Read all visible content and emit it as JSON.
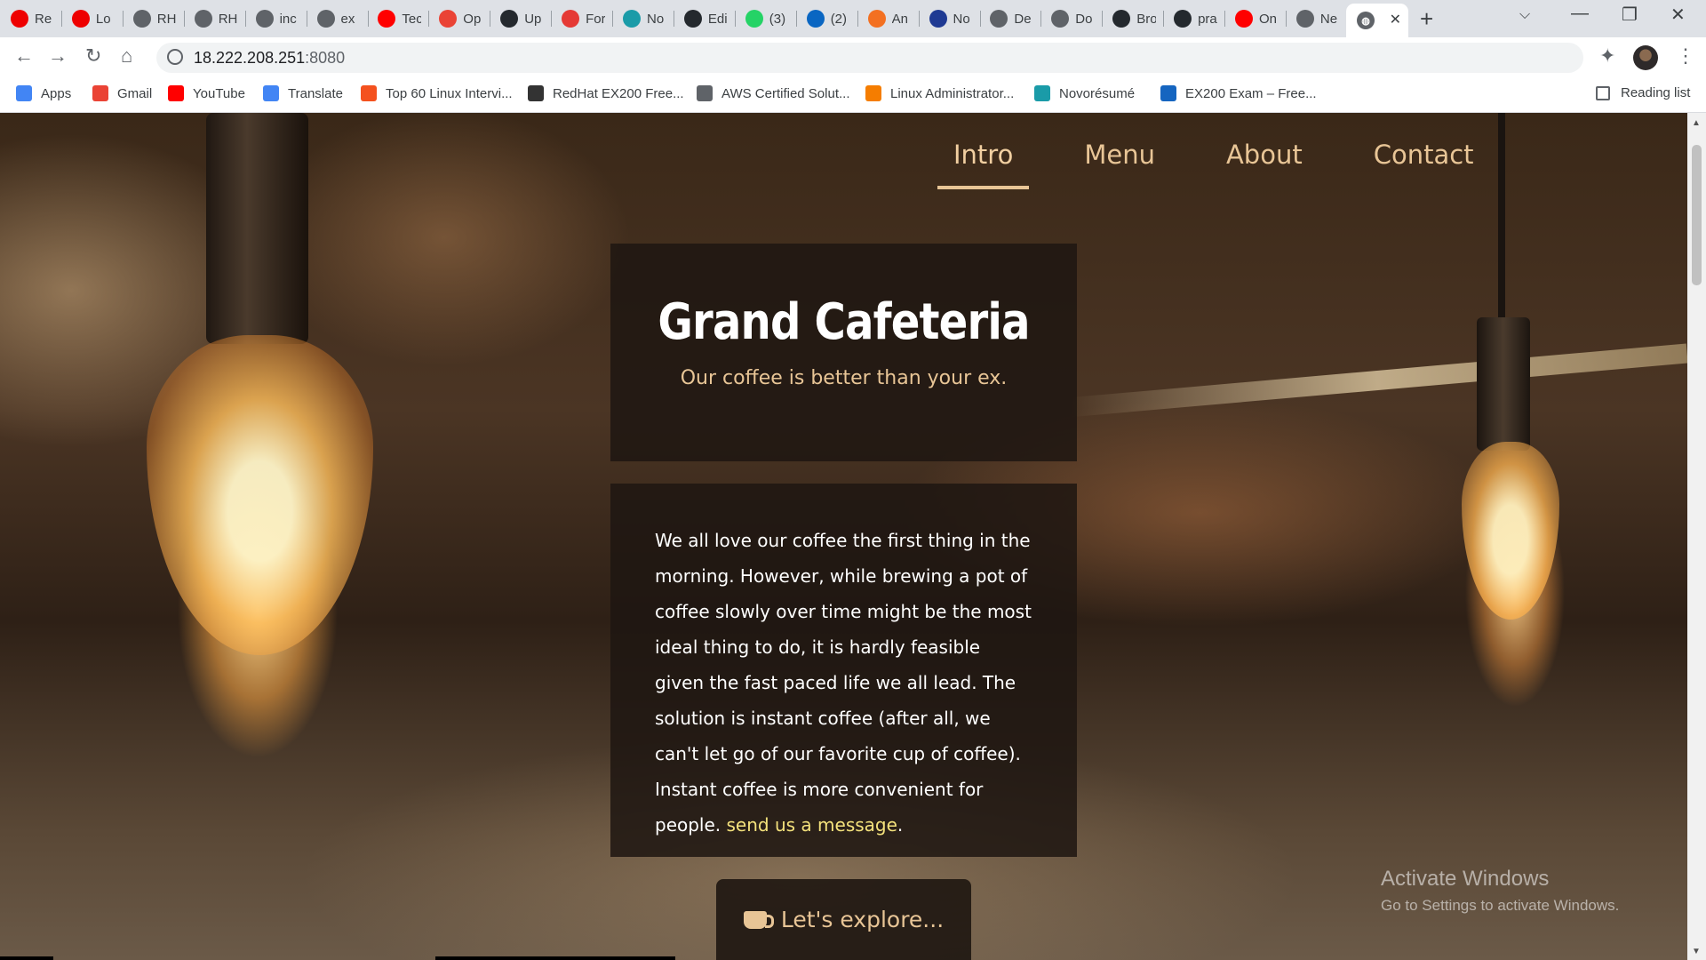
{
  "browser": {
    "tabs": [
      {
        "label": "Re",
        "icon": "redhat-icon",
        "color": "#e00"
      },
      {
        "label": "Lo",
        "icon": "redhat-icon",
        "color": "#e00"
      },
      {
        "label": "RH",
        "icon": "globe-icon",
        "color": "#5f6368"
      },
      {
        "label": "RH",
        "icon": "globe-icon",
        "color": "#5f6368"
      },
      {
        "label": "inc",
        "icon": "globe-icon",
        "color": "#5f6368"
      },
      {
        "label": "ex",
        "icon": "globe-icon",
        "color": "#5f6368"
      },
      {
        "label": "Tec",
        "icon": "youtube-icon",
        "color": "#f00"
      },
      {
        "label": "Op",
        "icon": "gmail-icon",
        "color": "#ea4335"
      },
      {
        "label": "Up",
        "icon": "github-icon",
        "color": "#24292e"
      },
      {
        "label": "For",
        "icon": "forms-icon",
        "color": "#e53935"
      },
      {
        "label": "No",
        "icon": "novoresume-icon",
        "color": "#1a9ba8"
      },
      {
        "label": "Edi",
        "icon": "github-icon",
        "color": "#24292e"
      },
      {
        "label": "(3)",
        "icon": "whatsapp-icon",
        "color": "#25d366"
      },
      {
        "label": "(2)",
        "icon": "linkedin-icon",
        "color": "#0a66c2"
      },
      {
        "label": "An",
        "icon": "ansible-icon",
        "color": "#f37021"
      },
      {
        "label": "No",
        "icon": "novoresume-icon",
        "color": "#1f3a93"
      },
      {
        "label": "De",
        "icon": "globe-icon",
        "color": "#5f6368"
      },
      {
        "label": "Do",
        "icon": "globe-icon",
        "color": "#5f6368"
      },
      {
        "label": "Bro",
        "icon": "github-icon",
        "color": "#24292e"
      },
      {
        "label": "pra",
        "icon": "github-icon",
        "color": "#24292e"
      },
      {
        "label": "On",
        "icon": "youtube-icon",
        "color": "#f00"
      },
      {
        "label": "Ne",
        "icon": "globe-icon",
        "color": "#5f6368"
      }
    ],
    "active_tab": {
      "icon": "globe-icon"
    },
    "url_host": "18.222.208.251",
    "url_port": ":8080",
    "bookmarks": [
      {
        "label": "Apps",
        "icon": "apps-grid-icon",
        "color": "#4285f4"
      },
      {
        "label": "Gmail",
        "icon": "gmail-icon",
        "color": "#ea4335"
      },
      {
        "label": "YouTube",
        "icon": "youtube-icon",
        "color": "#ff0000"
      },
      {
        "label": "Translate",
        "icon": "translate-icon",
        "color": "#4285f4"
      },
      {
        "label": "Top 60 Linux Intervi...",
        "icon": "site-icon",
        "color": "#f4511e"
      },
      {
        "label": "RedHat EX200 Free...",
        "icon": "site-icon",
        "color": "#333333"
      },
      {
        "label": "AWS Certified Solut...",
        "icon": "globe-icon",
        "color": "#5f6368"
      },
      {
        "label": "Linux Administrator...",
        "icon": "blogger-icon",
        "color": "#f57d00"
      },
      {
        "label": "Novorésumé",
        "icon": "novoresume-icon",
        "color": "#1a9ba8"
      },
      {
        "label": "EX200 Exam – Free...",
        "icon": "list-icon",
        "color": "#1565c0"
      }
    ],
    "reading_list": "Reading list"
  },
  "site": {
    "nav": [
      "Intro",
      "Menu",
      "About",
      "Contact"
    ],
    "title": "Grand Cafeteria",
    "tagline": "Our coffee is better than your ex.",
    "body_text": "We all love our coffee the first thing in the morning. However, while brewing a pot of coffee slowly over time might be the most ideal thing to do, it is hardly feasible given the fast paced life we all lead. The solution is instant coffee (after all, we can't let go of our favorite cup of coffee). Instant coffee is more convenient for people. ",
    "body_link": "send us a message",
    "body_end": ".",
    "explore_button": "Let's explore...",
    "accent_color": "#e8c596",
    "link_color": "#f4e27c"
  },
  "windows": {
    "watermark_title": "Activate Windows",
    "watermark_sub": "Go to Settings to activate Windows."
  }
}
